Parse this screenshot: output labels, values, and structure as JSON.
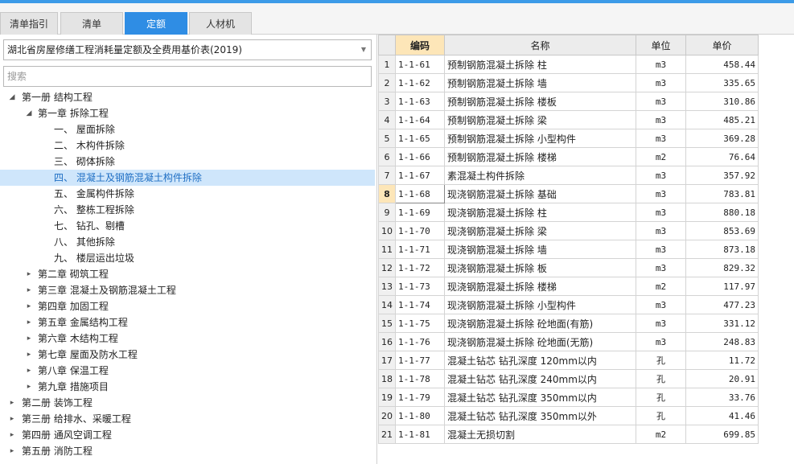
{
  "tabs": [
    {
      "label": "清单指引",
      "active": false
    },
    {
      "label": "清单",
      "active": false
    },
    {
      "label": "定额",
      "active": true
    },
    {
      "label": "人材机",
      "active": false
    }
  ],
  "quota_library": {
    "selected": "湖北省房屋修缮工程消耗量定额及全费用基价表(2019)"
  },
  "search": {
    "placeholder": "搜索"
  },
  "tree": [
    {
      "label": "第一册 结构工程",
      "expanded": true
    },
    {
      "label": "第一章 拆除工程",
      "expanded": true
    },
    {
      "label": "一、 屋面拆除"
    },
    {
      "label": "二、 木构件拆除"
    },
    {
      "label": "三、 砌体拆除"
    },
    {
      "label": "四、 混凝土及钢筋混凝土构件拆除",
      "selected": true
    },
    {
      "label": "五、 金属构件拆除"
    },
    {
      "label": "六、 整栋工程拆除"
    },
    {
      "label": "七、 钻孔、剔槽"
    },
    {
      "label": "八、 其他拆除"
    },
    {
      "label": "九、 楼层运出垃圾"
    },
    {
      "label": "第二章 砌筑工程",
      "expanded": false
    },
    {
      "label": "第三章 混凝土及钢筋混凝土工程",
      "expanded": false
    },
    {
      "label": "第四章 加固工程",
      "expanded": false
    },
    {
      "label": "第五章 金属结构工程",
      "expanded": false
    },
    {
      "label": "第六章 木结构工程",
      "expanded": false
    },
    {
      "label": "第七章 屋面及防水工程",
      "expanded": false
    },
    {
      "label": "第八章 保温工程",
      "expanded": false
    },
    {
      "label": "第九章 措施项目",
      "expanded": false
    },
    {
      "label": "第二册 装饰工程",
      "expanded": false
    },
    {
      "label": "第三册 给排水、采暖工程",
      "expanded": false
    },
    {
      "label": "第四册 通风空调工程",
      "expanded": false
    },
    {
      "label": "第五册 消防工程",
      "expanded": false
    }
  ],
  "table": {
    "headers": {
      "code": "编码",
      "name": "名称",
      "unit": "单位",
      "price": "单价"
    },
    "current_row": 8,
    "rows": [
      {
        "n": "1",
        "code": "1-1-61",
        "name": "预制钢筋混凝土拆除 柱",
        "unit": "m3",
        "price": "458.44"
      },
      {
        "n": "2",
        "code": "1-1-62",
        "name": "预制钢筋混凝土拆除 墙",
        "unit": "m3",
        "price": "335.65"
      },
      {
        "n": "3",
        "code": "1-1-63",
        "name": "预制钢筋混凝土拆除 楼板",
        "unit": "m3",
        "price": "310.86"
      },
      {
        "n": "4",
        "code": "1-1-64",
        "name": "预制钢筋混凝土拆除 梁",
        "unit": "m3",
        "price": "485.21"
      },
      {
        "n": "5",
        "code": "1-1-65",
        "name": "预制钢筋混凝土拆除 小型构件",
        "unit": "m3",
        "price": "369.28"
      },
      {
        "n": "6",
        "code": "1-1-66",
        "name": "预制钢筋混凝土拆除 楼梯",
        "unit": "m2",
        "price": "76.64"
      },
      {
        "n": "7",
        "code": "1-1-67",
        "name": "素混凝土构件拆除",
        "unit": "m3",
        "price": "357.92"
      },
      {
        "n": "8",
        "code": "1-1-68",
        "name": "现浇钢筋混凝土拆除 基础",
        "unit": "m3",
        "price": "783.81"
      },
      {
        "n": "9",
        "code": "1-1-69",
        "name": "现浇钢筋混凝土拆除 柱",
        "unit": "m3",
        "price": "880.18"
      },
      {
        "n": "10",
        "code": "1-1-70",
        "name": "现浇钢筋混凝土拆除 梁",
        "unit": "m3",
        "price": "853.69"
      },
      {
        "n": "11",
        "code": "1-1-71",
        "name": "现浇钢筋混凝土拆除 墙",
        "unit": "m3",
        "price": "873.18"
      },
      {
        "n": "12",
        "code": "1-1-72",
        "name": "现浇钢筋混凝土拆除 板",
        "unit": "m3",
        "price": "829.32"
      },
      {
        "n": "13",
        "code": "1-1-73",
        "name": "现浇钢筋混凝土拆除 楼梯",
        "unit": "m2",
        "price": "117.97"
      },
      {
        "n": "14",
        "code": "1-1-74",
        "name": "现浇钢筋混凝土拆除 小型构件",
        "unit": "m3",
        "price": "477.23"
      },
      {
        "n": "15",
        "code": "1-1-75",
        "name": "现浇钢筋混凝土拆除 砼地面(有筋)",
        "unit": "m3",
        "price": "331.12"
      },
      {
        "n": "16",
        "code": "1-1-76",
        "name": "现浇钢筋混凝土拆除 砼地面(无筋)",
        "unit": "m3",
        "price": "248.83"
      },
      {
        "n": "17",
        "code": "1-1-77",
        "name": "混凝土钻芯 钻孔深度 120mm以内",
        "unit": "孔",
        "price": "11.72"
      },
      {
        "n": "18",
        "code": "1-1-78",
        "name": "混凝土钻芯 钻孔深度 240mm以内",
        "unit": "孔",
        "price": "20.91"
      },
      {
        "n": "19",
        "code": "1-1-79",
        "name": "混凝土钻芯 钻孔深度 350mm以内",
        "unit": "孔",
        "price": "33.76"
      },
      {
        "n": "20",
        "code": "1-1-80",
        "name": "混凝土钻芯 钻孔深度 350mm以外",
        "unit": "孔",
        "price": "41.46"
      },
      {
        "n": "21",
        "code": "1-1-81",
        "name": "混凝土无损切割",
        "unit": "m2",
        "price": "699.85"
      }
    ]
  }
}
